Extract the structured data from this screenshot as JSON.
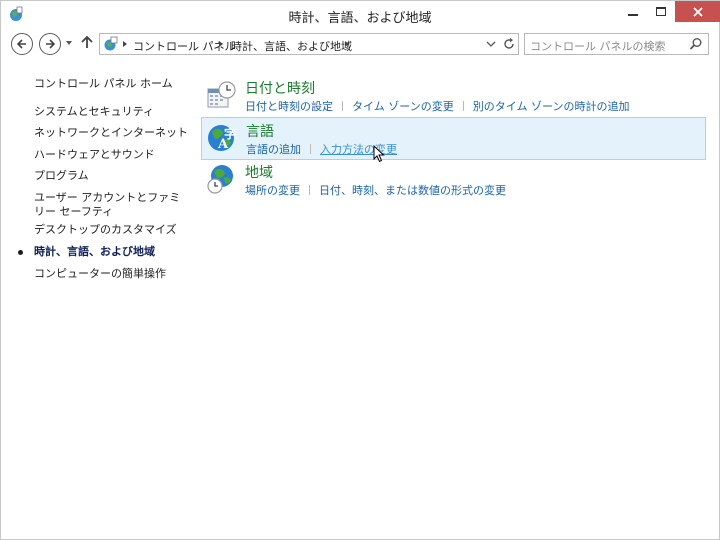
{
  "window": {
    "title": "時計、言語、および地域"
  },
  "address": {
    "breadcrumbs": [
      "コントロール パネル",
      "時計、言語、および地域"
    ]
  },
  "search": {
    "placeholder": "コントロール パネルの検索"
  },
  "sidebar": {
    "home": "コントロール パネル ホーム",
    "items": [
      {
        "label": "システムとセキュリティ"
      },
      {
        "label": "ネットワークとインターネット"
      },
      {
        "label": "ハードウェアとサウンド"
      },
      {
        "label": "プログラム"
      },
      {
        "label": "ユーザー アカウントとファミリー セーフティ"
      },
      {
        "label": "デスクトップのカスタマイズ"
      },
      {
        "label": "時計、言語、および地域",
        "current": true
      },
      {
        "label": "コンピューターの簡単操作"
      }
    ]
  },
  "categories": [
    {
      "title": "日付と時刻",
      "icon": "calendar-clock-icon",
      "links": [
        "日付と時刻の設定",
        "タイム ゾーンの変更",
        "別のタイム ゾーンの時計の追加"
      ]
    },
    {
      "title": "言語",
      "icon": "language-globe-icon",
      "links": [
        "言語の追加",
        "入力方法の変更"
      ]
    },
    {
      "title": "地域",
      "icon": "region-globe-clock-icon",
      "links": [
        "場所の変更",
        "日付、時刻、または数値の形式の変更"
      ]
    }
  ],
  "colors": {
    "category_title": "#1b7a2f",
    "link": "#1c63a6",
    "hover_bg": "#e3f2fb",
    "close_button": "#c75050"
  }
}
